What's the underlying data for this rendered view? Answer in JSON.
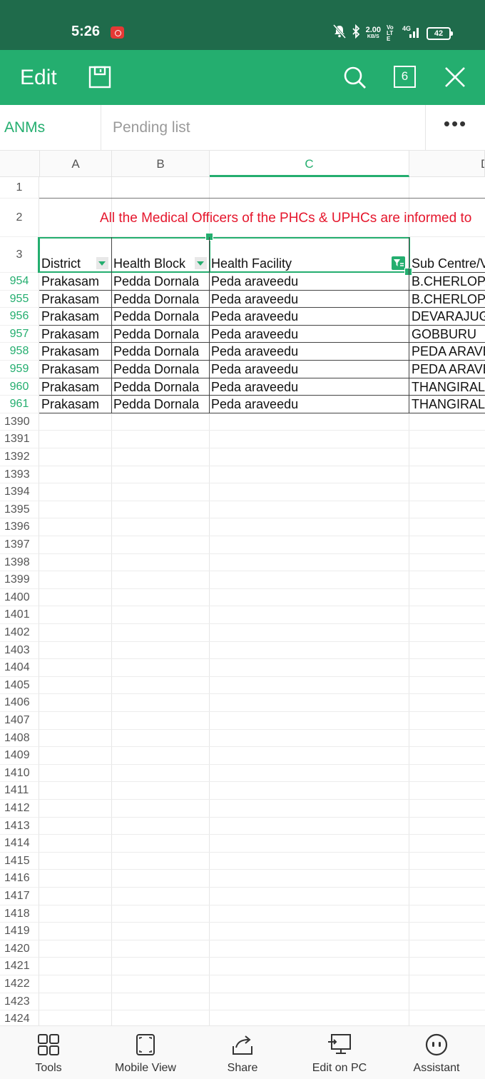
{
  "status_bar": {
    "time": "5:26",
    "net_speed": "2.00",
    "net_unit": "KB/S",
    "volte": "Vo LTE",
    "signal": "4G",
    "battery": "42"
  },
  "app_bar": {
    "title": "Edit",
    "window_count": "6"
  },
  "sheet_tabs": [
    {
      "label": "ANMs Aadhar",
      "active": true
    },
    {
      "label": "Pending list",
      "active": false
    }
  ],
  "more_label": "•••",
  "columns": [
    {
      "letter": "A"
    },
    {
      "letter": "B"
    },
    {
      "letter": "C",
      "selected": true
    },
    {
      "letter": "D"
    }
  ],
  "sheet": {
    "banner_row": "2",
    "banner_text": "All the Medical Officers of the PHCs & UPHCs are informed to",
    "header_row_number": "3",
    "headers": [
      "District",
      "Health Block",
      "Health Facility",
      "Sub Centre/V"
    ],
    "empty_row_number": "1",
    "rows": [
      {
        "num": "954",
        "cells": [
          "Prakasam",
          "Pedda Dornala",
          "Peda araveedu",
          "B.CHERLOPAL"
        ]
      },
      {
        "num": "955",
        "cells": [
          "Prakasam",
          "Pedda Dornala",
          "Peda araveedu",
          "B.CHERLOPAL"
        ]
      },
      {
        "num": "956",
        "cells": [
          "Prakasam",
          "Pedda Dornala",
          "Peda araveedu",
          "DEVARAJUGA"
        ]
      },
      {
        "num": "957",
        "cells": [
          "Prakasam",
          "Pedda Dornala",
          "Peda araveedu",
          "GOBBURU"
        ]
      },
      {
        "num": "958",
        "cells": [
          "Prakasam",
          "Pedda Dornala",
          "Peda araveedu",
          "PEDA ARAVE"
        ]
      },
      {
        "num": "959",
        "cells": [
          "Prakasam",
          "Pedda Dornala",
          "Peda araveedu",
          "PEDA ARAVE"
        ]
      },
      {
        "num": "960",
        "cells": [
          "Prakasam",
          "Pedda Dornala",
          "Peda araveedu",
          "THANGIRALL"
        ]
      },
      {
        "num": "961",
        "cells": [
          "Prakasam",
          "Pedda Dornala",
          "Peda araveedu",
          "THANGIRALL"
        ]
      }
    ],
    "empty_rows": [
      "1390",
      "1391",
      "1392",
      "1393",
      "1394",
      "1395",
      "1396",
      "1397",
      "1398",
      "1399",
      "1400",
      "1401",
      "1402",
      "1403",
      "1404",
      "1405",
      "1406",
      "1407",
      "1408",
      "1409",
      "1410",
      "1411",
      "1412",
      "1413",
      "1414",
      "1415",
      "1416",
      "1417",
      "1418",
      "1419",
      "1420",
      "1421",
      "1422",
      "1423",
      "1424"
    ]
  },
  "toolbar": [
    {
      "label": "Tools",
      "icon": "tools-icon"
    },
    {
      "label": "Mobile View",
      "icon": "mobile-view-icon"
    },
    {
      "label": "Share",
      "icon": "share-icon"
    },
    {
      "label": "Edit on PC",
      "icon": "edit-on-pc-icon"
    },
    {
      "label": "Assistant",
      "icon": "assistant-icon"
    }
  ],
  "colors": {
    "accent": "#24ae6f",
    "status_bar": "#1f6b4b",
    "banner_text": "#e5162c"
  }
}
